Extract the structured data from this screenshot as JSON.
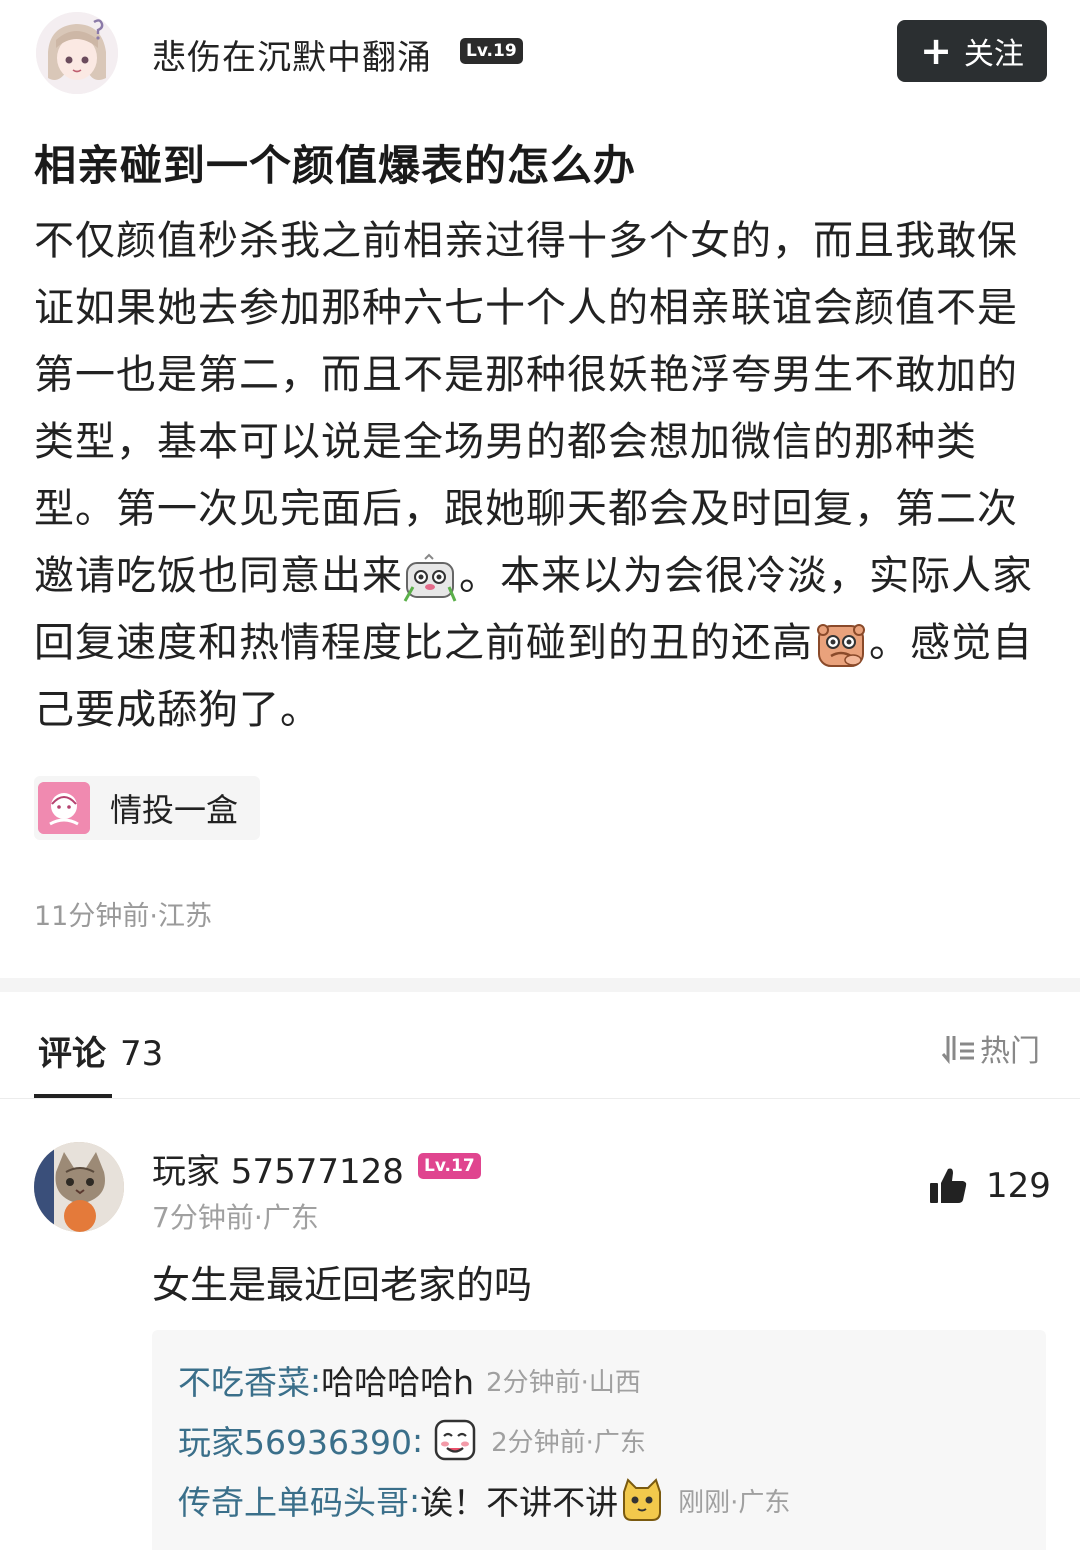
{
  "post": {
    "author": {
      "name": "悲伤在沉默中翻涌",
      "level": "Lv.19",
      "avatar_icon": "anime-girl-avatar"
    },
    "follow_label": "关注",
    "title": "相亲碰到一个颜值爆表的怎么办",
    "body": {
      "part1": "不仅颜值秒杀我之前相亲过得十多个女的，而且我敢保证如果她去参加那种六七十个人的相亲联谊会颜值不是第一也是第二，而且不是那种很妖艳浮夸男生不敢加的类型，基本可以说是全场男的都会想加微信的那种类型。第一次见完面后，跟她聊天都会及时回复，第二次邀请吃饭也同意出来",
      "emoji1": "panda-cheering-emoji",
      "part2": "。本来以为会很冷淡，实际人家回复速度和热情程度比之前碰到的丑的还高",
      "emoji2": "shy-bear-emoji",
      "part3": "。感觉自己要成舔狗了。"
    },
    "tag": {
      "label": "情投一盒",
      "icon": "tag-avatar-icon"
    },
    "meta": "11分钟前·江苏"
  },
  "comments_section": {
    "tab_label": "评论",
    "count": "73",
    "sort_label": "热门",
    "sort_icon": "sort-icon"
  },
  "comment": {
    "author": "玩家 57577128",
    "level": "Lv.17",
    "avatar_icon": "cat-avatar",
    "meta": "7分钟前·广东",
    "likes": "129",
    "text": "女生是最近回老家的吗",
    "replies": [
      {
        "name": "不吃香菜",
        "sep": ":",
        "text": " 哈哈哈哈h",
        "meta": "2分钟前·山西"
      },
      {
        "name": "玩家56936390",
        "sep": ":",
        "text": "",
        "emoji": "blushing-face-emoji",
        "meta": "2分钟前·广东"
      },
      {
        "name": "传奇上单码头哥",
        "sep": ":",
        "text": " 诶！不讲不讲",
        "emoji": "cat-face-emoji",
        "meta": "刚刚·广东"
      }
    ]
  },
  "colors": {
    "follow_bg": "#2b2f31",
    "level_badge_pink": "#e0458f",
    "reply_name": "#3a6f8a",
    "meta_gray": "#9a9a9a"
  }
}
